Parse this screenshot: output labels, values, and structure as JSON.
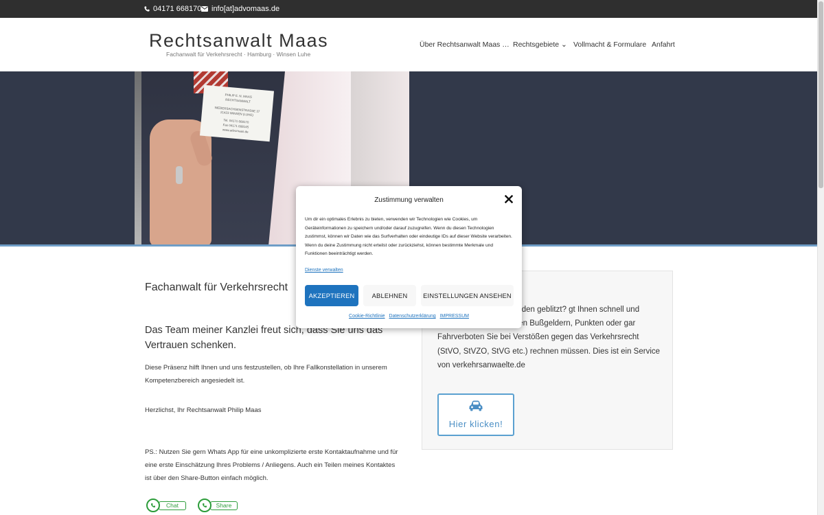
{
  "topbar": {
    "phone": "04171 668170",
    "email": "info[at]advomaas.de"
  },
  "header": {
    "title": "Rechtsanwalt Maas",
    "subtitle": "Fachanwalt für Verkehrsrecht · Hamburg · Winsen Luhe"
  },
  "nav": [
    {
      "label": "Über Rechtsanwalt Maas …"
    },
    {
      "label": "Rechtsgebiete ⌄"
    },
    {
      "label": "Vollmacht & Formulare"
    },
    {
      "label": "Anfahrt"
    }
  ],
  "card": {
    "name": "PHILIP E. N. MAAS",
    "role": "RECHTSANWALT",
    "street": "NIEDERSACHSENSTRASSE 37",
    "city": "21423 WINSEN (LUHE)",
    "tel": "Tel. 04171 668170",
    "fax": "Fax 04171 668145",
    "web": "www.advomaas.de"
  },
  "cookie": {
    "title": "Zustimmung verwalten",
    "text": "Um dir ein optimales Erlebnis zu bieten, verwenden wir Technologien wie Cookies, um Geräteinformationen zu speichern und/oder darauf zuzugreifen. Wenn du diesen Technologien zustimmst, können wir Daten wie das Surfverhalten oder eindeutige IDs auf dieser Website verarbeiten. Wenn du deine Zustimmung nicht erteilst oder zurückziehst, können bestimmte Merkmale und Funktionen beeinträchtigt werden.",
    "manage_link": "Dienste verwalten",
    "accept": "AKZEPTIEREN",
    "deny": "ABLEHNEN",
    "view": "EINSTELLUNGEN ANSEHEN",
    "links": [
      "Cookie-Richtlinie",
      "Datenschutzerklärung",
      "IMPRESSUM"
    ]
  },
  "main": {
    "heading": "Fachanwalt für Verkehrsrecht",
    "team": "Das Team meiner Kanzlei freut sich, dass Sie uns das Vertrauen schenken.",
    "p1": "Diese Präsenz hilft Ihnen und uns festzustellen, ob Ihre Fallkonstellation in unserem Kompetenzbereich angesiedelt ist.",
    "p2": "Herzlichst, Ihr Rechtsanwalt Philip Maas",
    "p3": "PS.: Nutzen Sie gern Whats App für eine unkomplizierte erste Kontaktaufnahme und für eine erste Einschätzung Ihres Problems / Anliegens. Auch ein Teilen meines Kontaktes ist über den Share-Button einfach möglich.",
    "wa_chat": "Chat",
    "wa_share": "Share"
  },
  "box": {
    "text": "ei Rot gefahren und wurden geblitzt? gt Ihnen schnell und übersichtlich, mit welchen Bußgeldern, Punkten oder gar Fahrverboten Sie bei Verstößen gegen das Verkehrsrecht (StVO, StVZO, StVG etc.) rechnen müssen. Dies ist ein Service von verkehrsanwaelte.de",
    "button": "Hier klicken!"
  },
  "colors": {
    "topbar": "#2f2f2f",
    "hero": "#32394a",
    "accent": "#1e73be",
    "whatsapp": "#2c9c3a"
  }
}
